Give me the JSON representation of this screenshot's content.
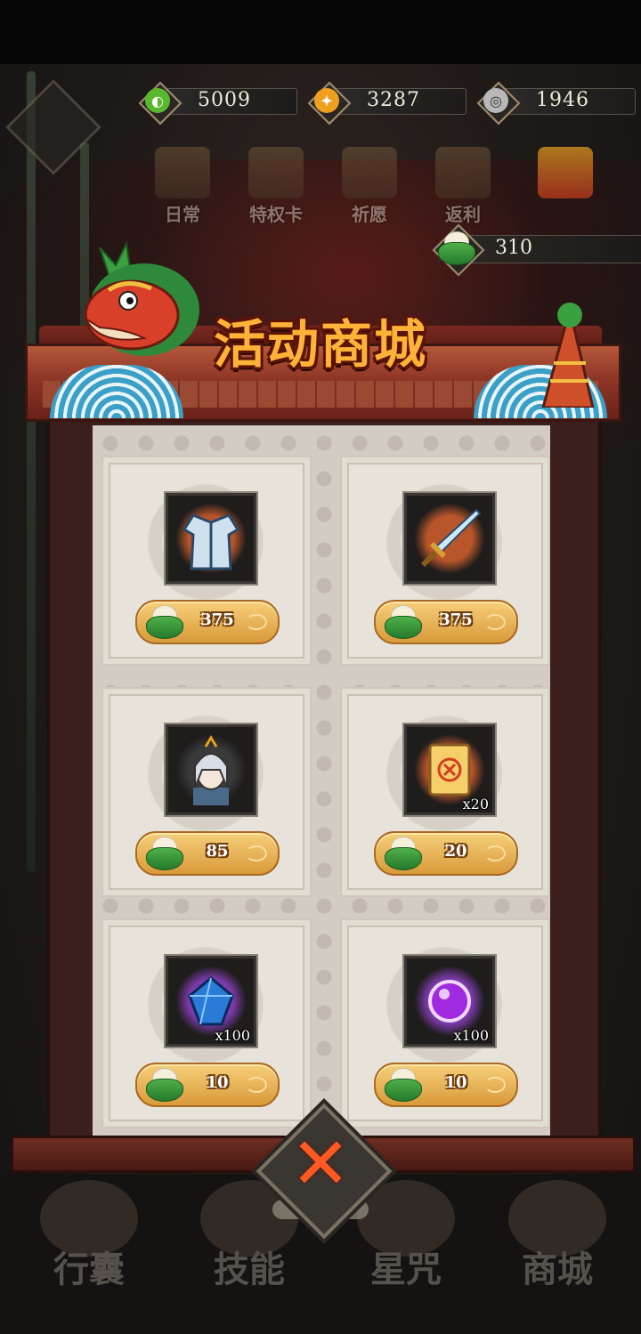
{
  "currencies": [
    {
      "id": "jade",
      "value": "5009",
      "color": "#5ab82e",
      "icon": "jade-orb-icon"
    },
    {
      "id": "gold",
      "value": "3287",
      "color": "#f0a020",
      "icon": "gold-coin-icon"
    },
    {
      "id": "silver",
      "value": "1946",
      "color": "#c8c8c8",
      "icon": "silver-coin-icon"
    }
  ],
  "tabs": [
    {
      "label": "日常"
    },
    {
      "label": "特权卡"
    },
    {
      "label": "祈愿"
    },
    {
      "label": "返利"
    }
  ],
  "event_currency": {
    "value": "310",
    "icon": "zongzi-icon"
  },
  "shop": {
    "title": "活动商城"
  },
  "items": [
    {
      "name": "blue-robe",
      "price": "375",
      "qty": "",
      "icon": "robe-icon",
      "glow": "#b8552a"
    },
    {
      "name": "sword",
      "price": "375",
      "qty": "",
      "icon": "sword-icon",
      "glow": "#b8552a"
    },
    {
      "name": "hero-portrait",
      "price": "85",
      "qty": "",
      "icon": "hero-portrait-icon",
      "glow": "#3a3a3a"
    },
    {
      "name": "scroll",
      "price": "20",
      "qty": "x20",
      "icon": "scroll-icon",
      "glow": "#b8552a"
    },
    {
      "name": "blue-gem",
      "price": "10",
      "qty": "x100",
      "icon": "blue-gem-icon",
      "glow": "#7a3aa8"
    },
    {
      "name": "purple-orb",
      "price": "10",
      "qty": "x100",
      "icon": "purple-orb-icon",
      "glow": "#7a3aa8"
    }
  ],
  "bottom_nav": [
    {
      "label": "行囊"
    },
    {
      "label": "技能"
    },
    {
      "label": "星咒"
    },
    {
      "label": "商城"
    }
  ],
  "close_icon": "close-icon"
}
